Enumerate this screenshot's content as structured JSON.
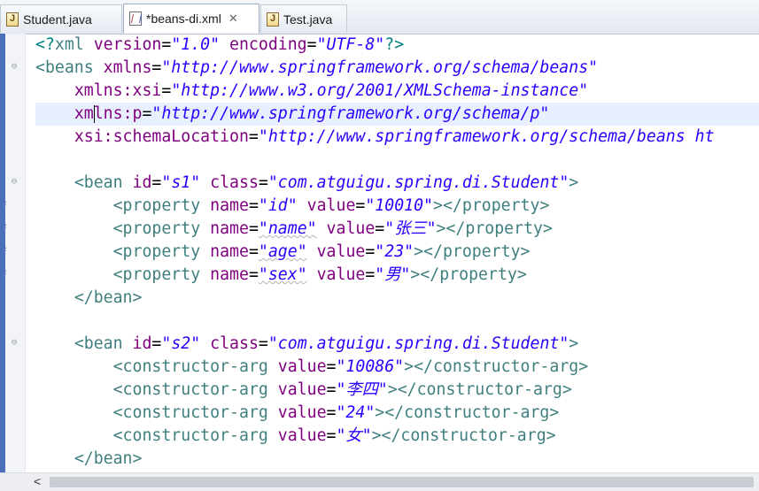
{
  "tabs": [
    {
      "label": "Student.java",
      "icon": "java-file-icon",
      "active": false
    },
    {
      "label": "*beans-di.xml",
      "icon": "xml-file-icon",
      "active": true,
      "close": "✕"
    },
    {
      "label": "Test.java",
      "icon": "java-file-icon",
      "active": false
    }
  ],
  "gutter": {
    "collapse_glyph": "⊖",
    "info_glyph": "i"
  },
  "code": [
    [
      [
        "p",
        "<?"
      ],
      [
        "t",
        "xml"
      ],
      [
        "txt",
        " "
      ],
      [
        "a",
        "version"
      ],
      [
        "txt",
        "="
      ],
      [
        "v",
        "\"1.0\""
      ],
      [
        "txt",
        " "
      ],
      [
        "a",
        "encoding"
      ],
      [
        "txt",
        "="
      ],
      [
        "v",
        "\"UTF-8\""
      ],
      [
        "p",
        "?>"
      ]
    ],
    [
      [
        "t",
        "<beans"
      ],
      [
        "txt",
        " "
      ],
      [
        "a",
        "xmlns"
      ],
      [
        "txt",
        "="
      ],
      [
        "v",
        "\"http://www.springframework.org/schema/beans\""
      ]
    ],
    [
      [
        "txt",
        "    "
      ],
      [
        "a",
        "xmlns:xsi"
      ],
      [
        "txt",
        "="
      ],
      [
        "v",
        "\"http://www.w3.org/2001/XMLSchema-instance\""
      ]
    ],
    [
      [
        "txt",
        "    "
      ],
      [
        "a",
        "xm"
      ],
      [
        "cursor",
        ""
      ],
      [
        "a",
        "lns:p"
      ],
      [
        "txt",
        "="
      ],
      [
        "v",
        "\"http://www.springframework.org/schema/p\""
      ]
    ],
    [
      [
        "txt",
        "    "
      ],
      [
        "a",
        "xsi:schemaLocation"
      ],
      [
        "txt",
        "="
      ],
      [
        "v",
        "\"http://www.springframework.org/schema/beans ht"
      ]
    ],
    [],
    [
      [
        "txt",
        "    "
      ],
      [
        "t",
        "<bean"
      ],
      [
        "txt",
        " "
      ],
      [
        "a",
        "id"
      ],
      [
        "txt",
        "="
      ],
      [
        "v",
        "\"s1\""
      ],
      [
        "txt",
        " "
      ],
      [
        "a",
        "class"
      ],
      [
        "txt",
        "="
      ],
      [
        "v",
        "\"com.atguigu.spring.di.Student\""
      ],
      [
        "t",
        ">"
      ]
    ],
    [
      [
        "txt",
        "        "
      ],
      [
        "t",
        "<property"
      ],
      [
        "txt",
        " "
      ],
      [
        "a",
        "name"
      ],
      [
        "txt",
        "="
      ],
      [
        "v",
        "\"id\""
      ],
      [
        "txt",
        " "
      ],
      [
        "a",
        "value"
      ],
      [
        "txt",
        "="
      ],
      [
        "v",
        "\"10010\""
      ],
      [
        "t",
        "></property>"
      ]
    ],
    [
      [
        "txt",
        "        "
      ],
      [
        "t",
        "<property"
      ],
      [
        "txt",
        " "
      ],
      [
        "a",
        "name"
      ],
      [
        "txt",
        "="
      ],
      [
        "vsq",
        "\"name\""
      ],
      [
        "txt",
        " "
      ],
      [
        "a",
        "value"
      ],
      [
        "txt",
        "="
      ],
      [
        "v",
        "\"张三\""
      ],
      [
        "t",
        "></property>"
      ]
    ],
    [
      [
        "txt",
        "        "
      ],
      [
        "t",
        "<property"
      ],
      [
        "txt",
        " "
      ],
      [
        "a",
        "name"
      ],
      [
        "txt",
        "="
      ],
      [
        "vsq",
        "\"age\""
      ],
      [
        "txt",
        " "
      ],
      [
        "a",
        "value"
      ],
      [
        "txt",
        "="
      ],
      [
        "v",
        "\"23\""
      ],
      [
        "t",
        "></property>"
      ]
    ],
    [
      [
        "txt",
        "        "
      ],
      [
        "t",
        "<property"
      ],
      [
        "txt",
        " "
      ],
      [
        "a",
        "name"
      ],
      [
        "txt",
        "="
      ],
      [
        "vsq",
        "\"sex\""
      ],
      [
        "txt",
        " "
      ],
      [
        "a",
        "value"
      ],
      [
        "txt",
        "="
      ],
      [
        "v",
        "\"男\""
      ],
      [
        "t",
        "></property>"
      ]
    ],
    [
      [
        "txt",
        "    "
      ],
      [
        "t",
        "</bean>"
      ]
    ],
    [],
    [
      [
        "txt",
        "    "
      ],
      [
        "t",
        "<bean"
      ],
      [
        "txt",
        " "
      ],
      [
        "a",
        "id"
      ],
      [
        "txt",
        "="
      ],
      [
        "v",
        "\"s2\""
      ],
      [
        "txt",
        " "
      ],
      [
        "a",
        "class"
      ],
      [
        "txt",
        "="
      ],
      [
        "v",
        "\"com.atguigu.spring.di.Student\""
      ],
      [
        "t",
        ">"
      ]
    ],
    [
      [
        "txt",
        "        "
      ],
      [
        "t",
        "<constructor-arg"
      ],
      [
        "txt",
        " "
      ],
      [
        "a",
        "value"
      ],
      [
        "txt",
        "="
      ],
      [
        "v",
        "\"10086\""
      ],
      [
        "t",
        "></constructor-arg>"
      ]
    ],
    [
      [
        "txt",
        "        "
      ],
      [
        "t",
        "<constructor-arg"
      ],
      [
        "txt",
        " "
      ],
      [
        "a",
        "value"
      ],
      [
        "txt",
        "="
      ],
      [
        "v",
        "\"李四\""
      ],
      [
        "t",
        "></constructor-arg>"
      ]
    ],
    [
      [
        "txt",
        "        "
      ],
      [
        "t",
        "<constructor-arg"
      ],
      [
        "txt",
        " "
      ],
      [
        "a",
        "value"
      ],
      [
        "txt",
        "="
      ],
      [
        "v",
        "\"24\""
      ],
      [
        "t",
        "></constructor-arg>"
      ]
    ],
    [
      [
        "txt",
        "        "
      ],
      [
        "t",
        "<constructor-arg"
      ],
      [
        "txt",
        " "
      ],
      [
        "a",
        "value"
      ],
      [
        "txt",
        "="
      ],
      [
        "v",
        "\"女\""
      ],
      [
        "t",
        "></constructor-arg>"
      ]
    ],
    [
      [
        "txt",
        "    "
      ],
      [
        "t",
        "</bean>"
      ]
    ]
  ],
  "selected_line": 3,
  "selected_text_from_segment": 6,
  "folds": [
    1,
    6,
    13
  ],
  "info_lines": [
    7,
    8,
    9,
    10
  ],
  "hscroll": {
    "left_arrow": "<"
  }
}
